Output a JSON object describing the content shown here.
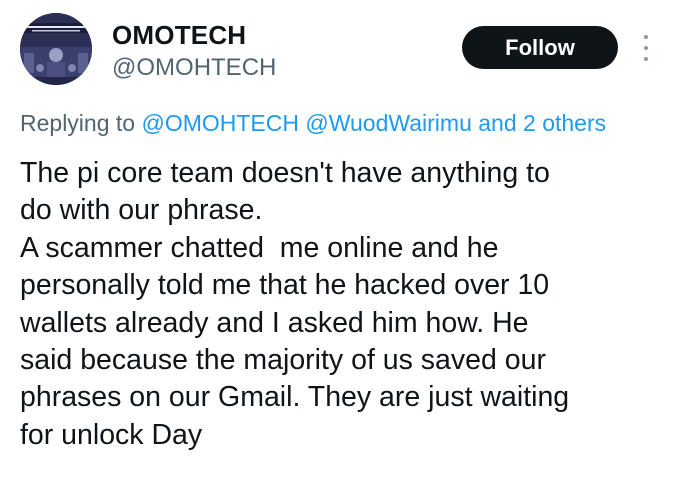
{
  "author": {
    "display_name": "OMOTECH",
    "handle": "@OMOHTECH"
  },
  "actions": {
    "follow_label": "Follow",
    "more_icon": "more-vertical-icon"
  },
  "reply_context": {
    "prefix": "Replying to",
    "mentions": [
      "@OMOHTECH",
      "@WuodWairimu"
    ],
    "conjunction": "and",
    "others_label": "2 others"
  },
  "tweet": {
    "lines": [
      "The pi core team doesn't have anything to",
      "do with our phrase.",
      "A scammer chatted  me online and he",
      "personally told me that he hacked over 10",
      "wallets already and I asked him how. He",
      "said because the majority of us saved our",
      "phrases on our Gmail. They are just waiting",
      "for unlock Day"
    ]
  },
  "colors": {
    "text_primary": "#0f1419",
    "text_secondary": "#536471",
    "link": "#1d9bf0",
    "follow_bg": "#0f1419",
    "follow_text": "#ffffff"
  }
}
